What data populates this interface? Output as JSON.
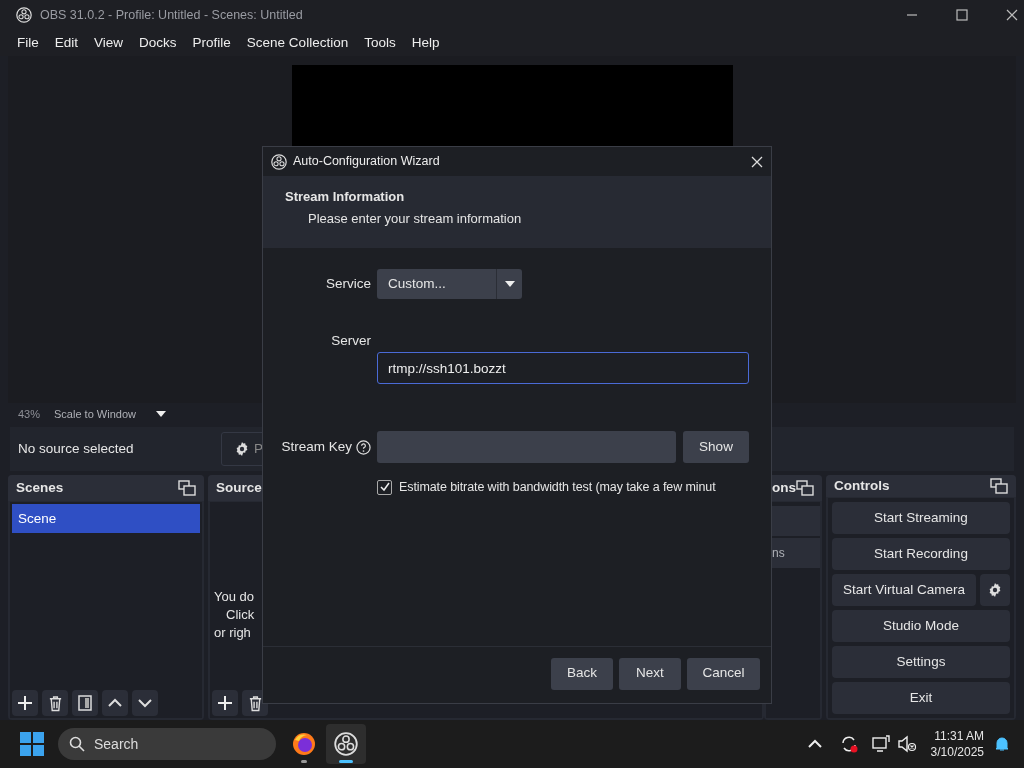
{
  "window": {
    "title": "OBS 31.0.2 - Profile: Untitled - Scenes: Untitled"
  },
  "menu": [
    "File",
    "Edit",
    "View",
    "Docks",
    "Profile",
    "Scene Collection",
    "Tools",
    "Help"
  ],
  "preview": {
    "zoom": "43%",
    "scale_mode": "Scale to Window"
  },
  "source_bar": {
    "label": "No source selected",
    "properties_button": "P"
  },
  "docks": {
    "scenes": {
      "title": "Scenes",
      "items": [
        {
          "label": "Scene",
          "selected": true
        }
      ]
    },
    "sources": {
      "title": "Source",
      "empty_text": [
        "You do",
        "Click",
        "or righ"
      ]
    },
    "transitions": {
      "title": "ons",
      "duration": "ns"
    },
    "controls": {
      "title": "Controls",
      "buttons": [
        {
          "label": "Start Streaming",
          "settings": false
        },
        {
          "label": "Start Recording",
          "settings": false
        },
        {
          "label": "Start Virtual Camera",
          "settings": true
        },
        {
          "label": "Studio Mode",
          "settings": false
        },
        {
          "label": "Settings",
          "settings": false
        },
        {
          "label": "Exit",
          "settings": false
        }
      ]
    }
  },
  "dialog": {
    "title": "Auto-Configuration Wizard",
    "heading": "Stream Information",
    "subheading": "Please enter your stream information",
    "service": {
      "label": "Service",
      "value": "Custom..."
    },
    "server": {
      "label": "Server",
      "value": "rtmp://ssh101.bozzt"
    },
    "stream_key": {
      "label": "Stream Key",
      "show_button": "Show"
    },
    "bandwidth_test": {
      "label": "Estimate bitrate with bandwidth test (may take a few minut",
      "checked": true
    },
    "buttons": [
      "Back",
      "Next",
      "Cancel"
    ]
  },
  "taskbar": {
    "search": {
      "placeholder": "Search"
    },
    "apps": [
      {
        "kind": "firefox",
        "selected": false
      },
      {
        "kind": "obs",
        "selected": true
      }
    ],
    "time": "11:31 AM",
    "date": "3/10/2025"
  }
}
